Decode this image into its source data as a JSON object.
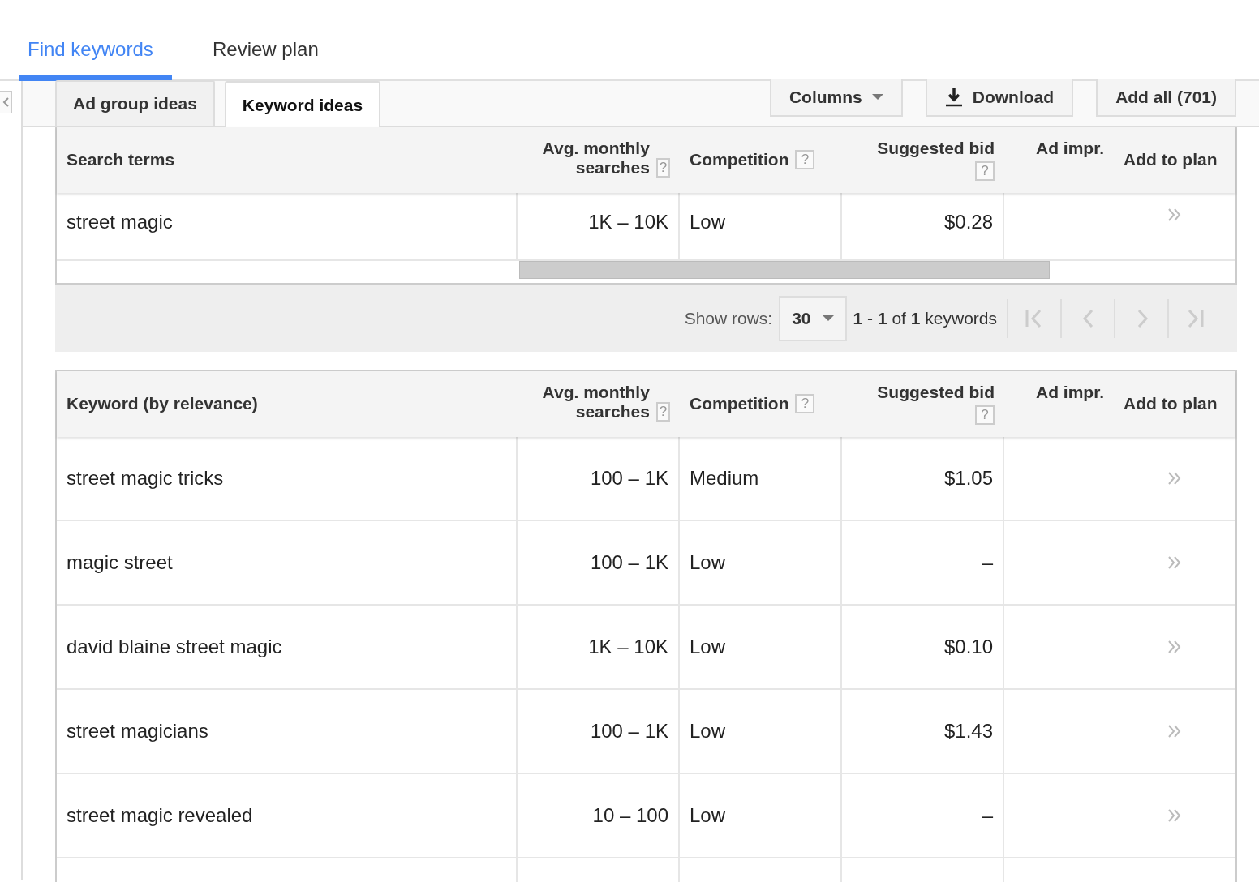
{
  "top_tabs": [
    {
      "label": "Find keywords",
      "selected": true
    },
    {
      "label": "Review plan",
      "selected": false
    }
  ],
  "sub_tabs": [
    {
      "label": "Ad group ideas",
      "selected": false
    },
    {
      "label": "Keyword ideas",
      "selected": true
    }
  ],
  "toolbar": {
    "columns": "Columns",
    "download": "Download",
    "add_all": "Add all (701)"
  },
  "search_table": {
    "columns": [
      {
        "label": "Search terms"
      },
      {
        "label": "Avg. monthly searches",
        "help": "?"
      },
      {
        "label": "Competition",
        "help": "?"
      },
      {
        "label": "Suggested bid",
        "help": "?"
      },
      {
        "label": "Ad impr."
      },
      {
        "label": "Add to plan"
      }
    ],
    "rows": [
      {
        "keyword": "street magic",
        "searches": "1K – 10K",
        "competition": "Low",
        "bid": "$0.28"
      }
    ]
  },
  "pager": {
    "label": "Show rows:",
    "rows": "30",
    "range": "**1** - **1** of **1** keywords"
  },
  "ideas_table": {
    "columns": [
      {
        "label": "Keyword (by relevance)"
      },
      {
        "label": "Avg. monthly searches",
        "help": "?"
      },
      {
        "label": "Competition",
        "help": "?"
      },
      {
        "label": "Suggested bid",
        "help": "?"
      },
      {
        "label": "Ad impr."
      },
      {
        "label": "Add to plan"
      }
    ],
    "rows": [
      {
        "keyword": "street magic tricks",
        "searches": "100 – 1K",
        "competition": "Medium",
        "bid": "$1.05"
      },
      {
        "keyword": "magic street",
        "searches": "100 – 1K",
        "competition": "Low",
        "bid": "–"
      },
      {
        "keyword": "david blaine street magic",
        "searches": "1K – 10K",
        "competition": "Low",
        "bid": "$0.10"
      },
      {
        "keyword": "street magicians",
        "searches": "100 – 1K",
        "competition": "Low",
        "bid": "$1.43"
      },
      {
        "keyword": "street magic revealed",
        "searches": "10 – 100",
        "competition": "Low",
        "bid": "–"
      }
    ]
  }
}
